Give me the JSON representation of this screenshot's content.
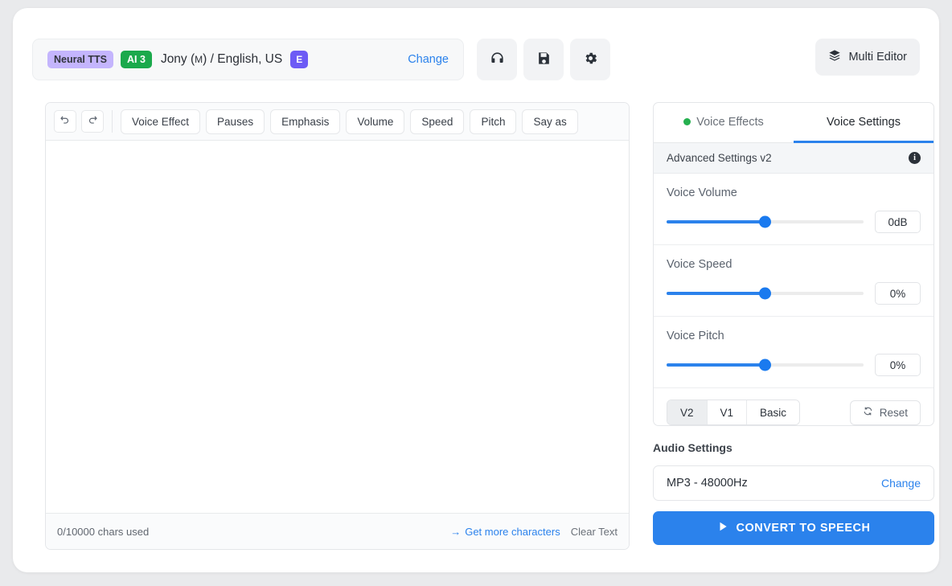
{
  "header": {
    "voice": {
      "neural_badge": "Neural TTS",
      "ai_badge": "AI 3",
      "name_main": "Jony (",
      "name_gender": "M",
      "name_rest": ") / English, US",
      "e_badge": "E",
      "change_label": "Change"
    },
    "icons": {
      "listen": "headphones-icon",
      "save": "floppy-disk-icon",
      "settings": "gear-icon"
    },
    "multi_editor_label": "Multi Editor"
  },
  "editor": {
    "history": {
      "undo": "undo-icon",
      "redo": "redo-icon"
    },
    "tools": [
      {
        "label": "Voice Effect"
      },
      {
        "label": "Pauses"
      },
      {
        "label": "Emphasis"
      },
      {
        "label": "Volume"
      },
      {
        "label": "Speed"
      },
      {
        "label": "Pitch"
      },
      {
        "label": "Say as"
      }
    ],
    "text_value": "",
    "placeholder": "",
    "footer": {
      "chars_used": "0/10000 chars used",
      "get_more_arrow": "→",
      "get_more_label": "Get more characters",
      "clear_label": "Clear Text"
    }
  },
  "settings": {
    "tabs": [
      {
        "label": "Voice Effects",
        "active": false,
        "dot": true
      },
      {
        "label": "Voice Settings",
        "active": true,
        "dot": false
      }
    ],
    "advanced_label": "Advanced Settings v2",
    "info_glyph": "i",
    "sliders": [
      {
        "label": "Voice Volume",
        "value": "0dB",
        "percent": 50
      },
      {
        "label": "Voice Speed",
        "value": "0%",
        "percent": 50
      },
      {
        "label": "Voice Pitch",
        "value": "0%",
        "percent": 50
      }
    ],
    "presets": [
      {
        "label": "V2",
        "active": true
      },
      {
        "label": "V1",
        "active": false
      },
      {
        "label": "Basic",
        "active": false
      }
    ],
    "reset_label": "Reset"
  },
  "audio": {
    "title": "Audio Settings",
    "format": "MP3 - 48000Hz",
    "change_label": "Change"
  },
  "convert": {
    "label": "CONVERT TO SPEECH"
  },
  "colors": {
    "accent": "#2b82ec",
    "neural_badge_bg": "#c4b5fd",
    "ai_badge_bg": "#1ba94c",
    "e_badge_bg": "#6d5bf5",
    "dot_green": "#25b04f"
  }
}
